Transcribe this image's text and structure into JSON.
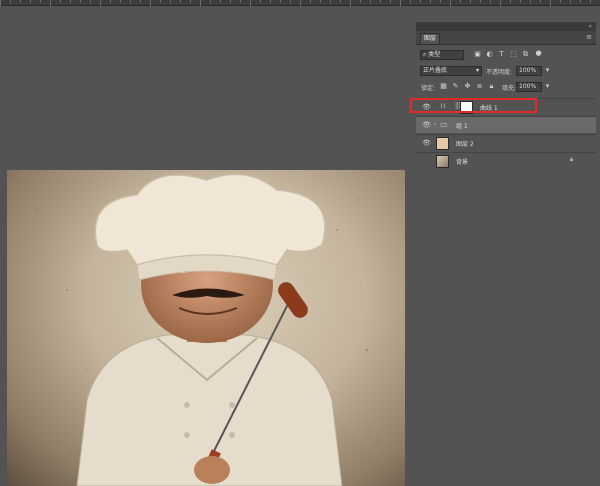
{
  "panel": {
    "tab_label": "图层",
    "menu_icon": "≡",
    "collapse_icon": "«",
    "filter": {
      "label": "类型"
    },
    "blend_mode": "正片叠底",
    "opacity_label": "不透明度:",
    "opacity_value": "100%",
    "lock_label": "锁定:",
    "fill_label": "填充:",
    "fill_value": "100%"
  },
  "layers": [
    {
      "name": "曲线 1",
      "type": "adjustment",
      "visible": true,
      "selected": false,
      "highlighted": true
    },
    {
      "name": "组 1",
      "type": "group",
      "visible": true,
      "selected": true
    },
    {
      "name": "图层 2",
      "type": "fill",
      "visible": true,
      "selected": false,
      "color": "#e8c9a6"
    },
    {
      "name": "背景",
      "type": "image",
      "visible": false,
      "selected": false,
      "locked": true
    }
  ],
  "colors": {
    "highlight": "#e32a2a",
    "selected_layer": "#6a6a6a"
  }
}
